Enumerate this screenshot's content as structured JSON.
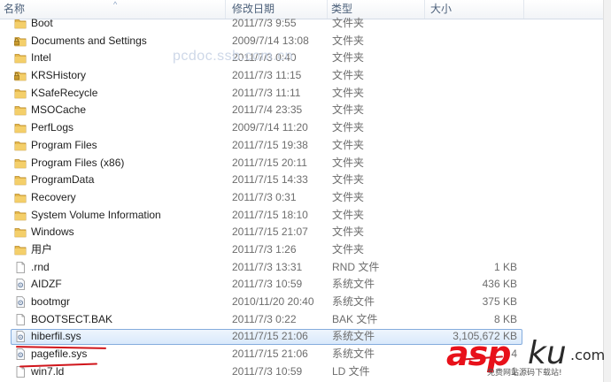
{
  "header": {
    "columns": [
      "名称",
      "修改日期",
      "类型",
      "大小"
    ],
    "sort_indicator": "^"
  },
  "watermark": "pcdoc.ssb.com.cn",
  "logo": {
    "main": "asp",
    "accent": "ku",
    "tld": ".com",
    "sub": "免费网站源码下载站!"
  },
  "colors": {
    "folder": "#e6b94e",
    "selection_border": "#84acdd",
    "annotation": "#d0151b"
  },
  "rows": [
    {
      "name": "Boot",
      "date": "2011/7/3 9:55",
      "type": "文件夹",
      "size": "",
      "icon": "folder-icon"
    },
    {
      "name": "Documents and Settings",
      "date": "2009/7/14 13:08",
      "type": "文件夹",
      "size": "",
      "icon": "locked-folder-icon"
    },
    {
      "name": "Intel",
      "date": "2011/7/3 0:40",
      "type": "文件夹",
      "size": "",
      "icon": "folder-icon"
    },
    {
      "name": "KRSHistory",
      "date": "2011/7/3 11:15",
      "type": "文件夹",
      "size": "",
      "icon": "locked-folder-icon"
    },
    {
      "name": "KSafeRecycle",
      "date": "2011/7/3 11:11",
      "type": "文件夹",
      "size": "",
      "icon": "folder-icon"
    },
    {
      "name": "MSOCache",
      "date": "2011/7/4 23:35",
      "type": "文件夹",
      "size": "",
      "icon": "folder-icon"
    },
    {
      "name": "PerfLogs",
      "date": "2009/7/14 11:20",
      "type": "文件夹",
      "size": "",
      "icon": "folder-icon"
    },
    {
      "name": "Program Files",
      "date": "2011/7/15 19:38",
      "type": "文件夹",
      "size": "",
      "icon": "folder-icon"
    },
    {
      "name": "Program Files (x86)",
      "date": "2011/7/15 20:11",
      "type": "文件夹",
      "size": "",
      "icon": "folder-icon"
    },
    {
      "name": "ProgramData",
      "date": "2011/7/15 14:33",
      "type": "文件夹",
      "size": "",
      "icon": "folder-icon"
    },
    {
      "name": "Recovery",
      "date": "2011/7/3 0:31",
      "type": "文件夹",
      "size": "",
      "icon": "folder-icon"
    },
    {
      "name": "System Volume Information",
      "date": "2011/7/15 18:10",
      "type": "文件夹",
      "size": "",
      "icon": "folder-icon"
    },
    {
      "name": "Windows",
      "date": "2011/7/15 21:07",
      "type": "文件夹",
      "size": "",
      "icon": "folder-icon"
    },
    {
      "name": "用户",
      "date": "2011/7/3 1:26",
      "type": "文件夹",
      "size": "",
      "icon": "folder-icon"
    },
    {
      "name": ".rnd",
      "date": "2011/7/3 13:31",
      "type": "RND 文件",
      "size": "1 KB",
      "icon": "blank-file-icon"
    },
    {
      "name": "AIDZF",
      "date": "2011/7/3 10:59",
      "type": "系统文件",
      "size": "436 KB",
      "icon": "system-file-icon"
    },
    {
      "name": "bootmgr",
      "date": "2010/11/20 20:40",
      "type": "系统文件",
      "size": "375 KB",
      "icon": "system-file-icon"
    },
    {
      "name": "BOOTSECT.BAK",
      "date": "2011/7/3 0:22",
      "type": "BAK 文件",
      "size": "8 KB",
      "icon": "blank-file-icon"
    },
    {
      "name": "hiberfil.sys",
      "date": "2011/7/15 21:06",
      "type": "系统文件",
      "size": "3,105,672 KB",
      "icon": "system-file-icon",
      "selected": true
    },
    {
      "name": "pagefile.sys",
      "date": "2011/7/15 21:06",
      "type": "系统文件",
      "size": "4",
      "icon": "system-file-icon"
    },
    {
      "name": "win7.ld",
      "date": "2011/7/3 10:59",
      "type": "LD 文件",
      "size": "1",
      "icon": "blank-file-icon"
    }
  ]
}
